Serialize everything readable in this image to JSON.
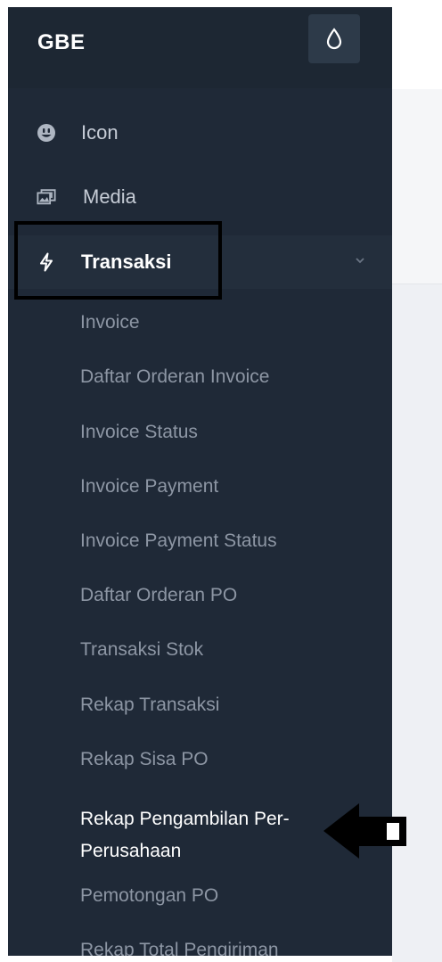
{
  "sidebar": {
    "brand": "GBE",
    "theme_toggle_icon": "droplet-icon",
    "items": [
      {
        "label": "Icon",
        "icon": "smiley-icon"
      },
      {
        "label": "Media",
        "icon": "images-icon"
      },
      {
        "label": "Transaksi",
        "icon": "lightning-icon",
        "expanded": true
      }
    ],
    "submenu": [
      "Invoice",
      "Daftar Orderan Invoice",
      "Invoice Status",
      "Invoice Payment",
      "Invoice Payment Status",
      "Daftar Orderan PO",
      "Transaksi Stok",
      "Rekap Transaksi",
      "Rekap Sisa PO",
      "Rekap Pengambilan Per-Perusahaan",
      "Pemotongan PO",
      "Rekap Total Pengiriman"
    ],
    "current_submenu_index": 9
  },
  "colors": {
    "sidebar_bg": "#1f2937",
    "active_text": "#ffffff",
    "inactive_text": "#8d96a4",
    "annotation": "#000000"
  }
}
